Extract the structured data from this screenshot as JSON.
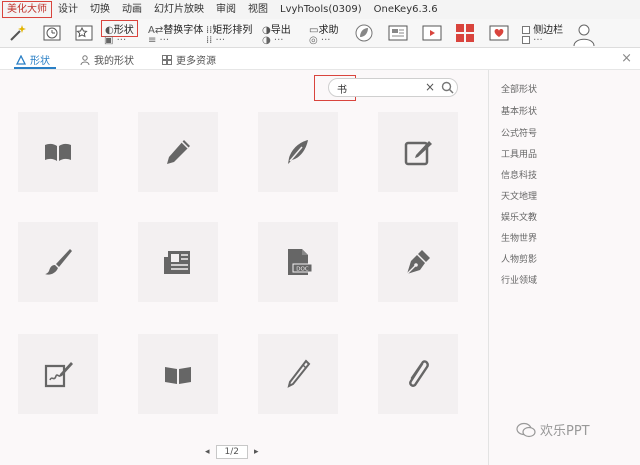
{
  "menubar": {
    "items": [
      "美化大师",
      "设计",
      "切换",
      "动画",
      "幻灯片放映",
      "审阅",
      "视图",
      "LvyhTools(0309)",
      "OneKey6.3.6"
    ]
  },
  "ribbon": {
    "shape_label": "形状",
    "replace_font_label": "替换字体",
    "rect_arrange_label": "矩形排列",
    "export_label": "导出",
    "help_label": "求助",
    "sidebar_check_label": "侧边栏"
  },
  "tabs": {
    "items": [
      "形状",
      "我的形状",
      "更多资源"
    ],
    "close": "×"
  },
  "search": {
    "value": "书",
    "clear": "×"
  },
  "sidebar": {
    "categories": [
      "全部形状",
      "基本形状",
      "公式符号",
      "工具用品",
      "信息科技",
      "天文地理",
      "娱乐文教",
      "生物世界",
      "人物剪影",
      "行业领域"
    ]
  },
  "tiles": [
    "book-icon",
    "pencil-icon",
    "feather-pen-icon",
    "edit-note-icon",
    "brush-icon",
    "newspaper-icon",
    "word-doc-icon",
    "fountain-pen-icon",
    "signed-paper-icon",
    "open-book-icon",
    "slim-pencil-icon",
    "paperclip-icon"
  ],
  "pager": {
    "prev": "◂",
    "page": "1/2",
    "next": "▸"
  },
  "watermark": {
    "text": "欢乐PPT"
  },
  "colors": {
    "accent_red": "#d9443d",
    "tab_blue": "#2a7fc5",
    "icon_gray": "#666666"
  }
}
